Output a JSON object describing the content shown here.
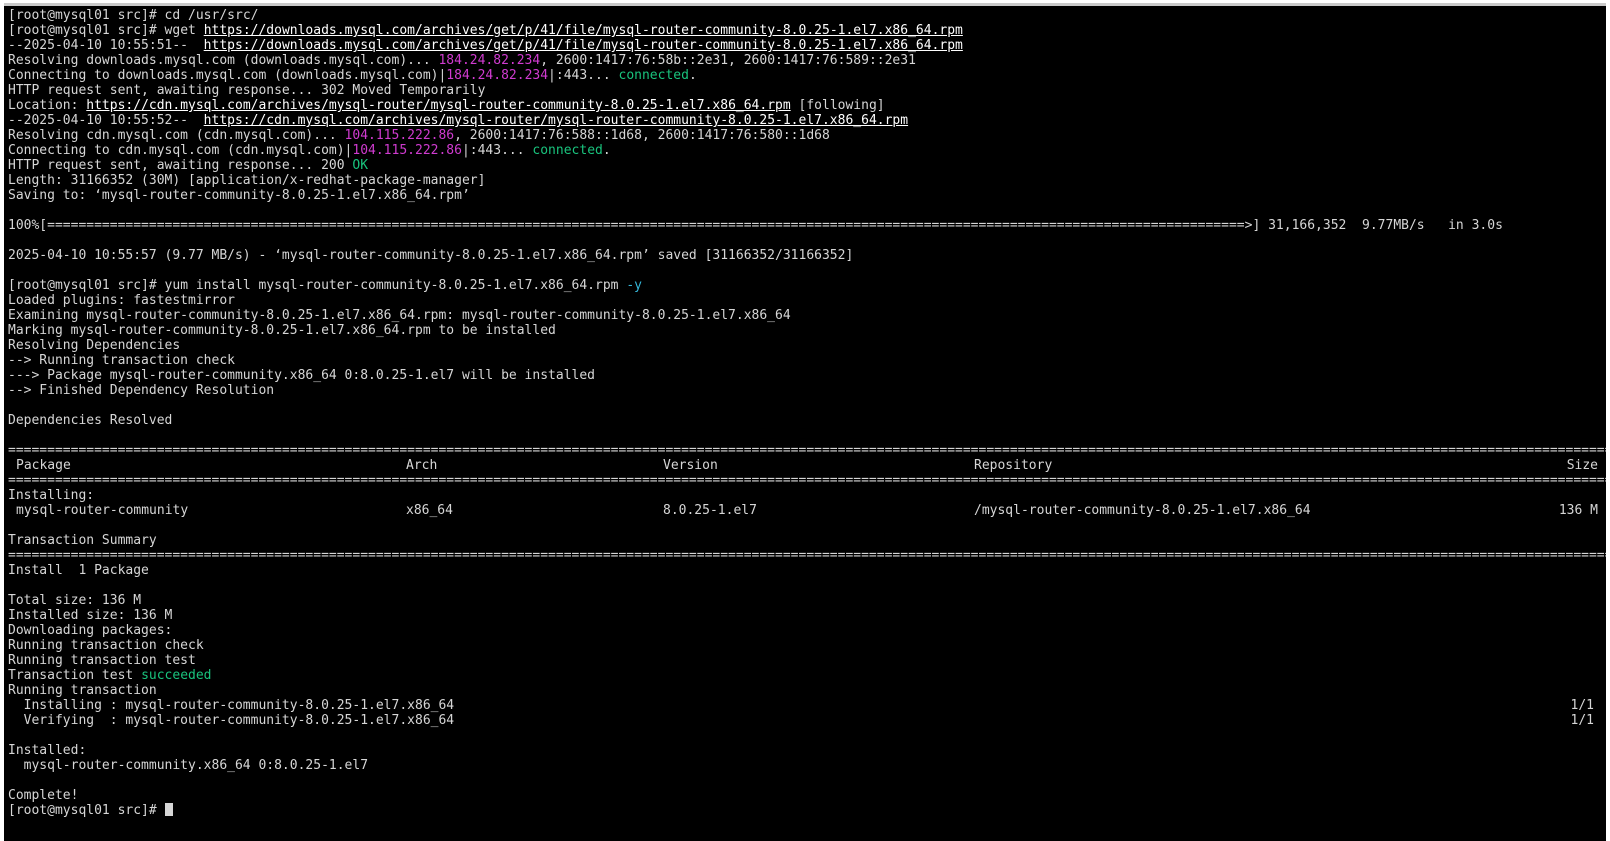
{
  "colors": {
    "background": "#000000",
    "text": "#d6d6d6",
    "ip": "#d03bd0",
    "success": "#19c37d",
    "flag": "#35b6d8"
  },
  "prompt": "[root@mysql01 src]# ",
  "cmd_cd": "cd /usr/src/",
  "cmd_wget": "wget ",
  "url_rpm": "https://downloads.mysql.com/archives/get/p/41/file/mysql-router-community-8.0.25-1.el7.x86_64.rpm",
  "wget_ts1": "--2025-04-10 10:55:51--  ",
  "resolving1_pre": "Resolving downloads.mysql.com (downloads.mysql.com)... ",
  "resolving1_ip": "184.24.82.234",
  "resolving1_post": ", 2600:1417:76:58b::2e31, 2600:1417:76:589::2e31",
  "connecting1_pre": "Connecting to downloads.mysql.com (downloads.mysql.com)|",
  "connecting1_ip": "184.24.82.234",
  "connecting1_mid": "|:443... ",
  "connected": "connected",
  "period": ".",
  "http1": "HTTP request sent, awaiting response... 302 Moved Temporarily",
  "location_pre": "Location: ",
  "location_url": "https://cdn.mysql.com/archives/mysql-router/mysql-router-community-8.0.25-1.el7.x86_64.rpm",
  "location_post": " [following]",
  "wget_ts2": "--2025-04-10 10:55:52--  ",
  "resolving2_pre": "Resolving cdn.mysql.com (cdn.mysql.com)... ",
  "resolving2_ip": "104.115.222.86",
  "resolving2_post": ", 2600:1417:76:588::1d68, 2600:1417:76:580::1d68",
  "connecting2_pre": "Connecting to cdn.mysql.com (cdn.mysql.com)|",
  "connecting2_ip": "104.115.222.86",
  "connecting2_mid": "|:443... ",
  "http2_pre": "HTTP request sent, awaiting response... 200 ",
  "http2_ok": "OK",
  "length": "Length: 31166352 (30M) [application/x-redhat-package-manager]",
  "saving": "Saving to: ‘mysql-router-community-8.0.25-1.el7.x86_64.rpm’",
  "progress_left": "100%[=========================================================================================================================================================>] 31,166,352  9.77MB/s   in 3.0s",
  "saved": "2025-04-10 10:55:57 (9.77 MB/s) - ‘mysql-router-community-8.0.25-1.el7.x86_64.rpm’ saved [31166352/31166352]",
  "cmd_yum": "yum install mysql-router-community-8.0.25-1.el7.x86_64.rpm ",
  "cmd_yum_flag": "-y",
  "yum_lines": [
    "Loaded plugins: fastestmirror",
    "Examining mysql-router-community-8.0.25-1.el7.x86_64.rpm: mysql-router-community-8.0.25-1.el7.x86_64",
    "Marking mysql-router-community-8.0.25-1.el7.x86_64.rpm to be installed",
    "Resolving Dependencies",
    "--> Running transaction check",
    "---> Package mysql-router-community.x86_64 0:8.0.25-1.el7 will be installed",
    "--> Finished Dependency Resolution"
  ],
  "deps_resolved": "Dependencies Resolved",
  "table": {
    "headers": [
      "Package",
      "Arch",
      "Version",
      "Repository",
      "Size"
    ],
    "installing_label": "Installing:",
    "row": [
      "mysql-router-community",
      "x86_64",
      "8.0.25-1.el7",
      "/mysql-router-community-8.0.25-1.el7.x86_64",
      "136 M"
    ]
  },
  "transaction_summary": "Transaction Summary",
  "install_count": "Install  1 Package",
  "total_size": "Total size: 136 M",
  "installed_size": "Installed size: 136 M",
  "downloading": "Downloading packages:",
  "running_check": "Running transaction check",
  "running_test": "Running transaction test",
  "test_pre": "Transaction test ",
  "test_succeeded": "succeeded",
  "running_tx": "Running transaction",
  "step_installing": "  Installing : mysql-router-community-8.0.25-1.el7.x86_64",
  "step_verifying": "  Verifying  : mysql-router-community-8.0.25-1.el7.x86_64",
  "step_count": "1/1",
  "installed_label": "Installed:",
  "installed_pkg": "  mysql-router-community.x86_64 0:8.0.25-1.el7",
  "complete": "Complete!",
  "separator": "======================================================================================================================================================================================================================================"
}
